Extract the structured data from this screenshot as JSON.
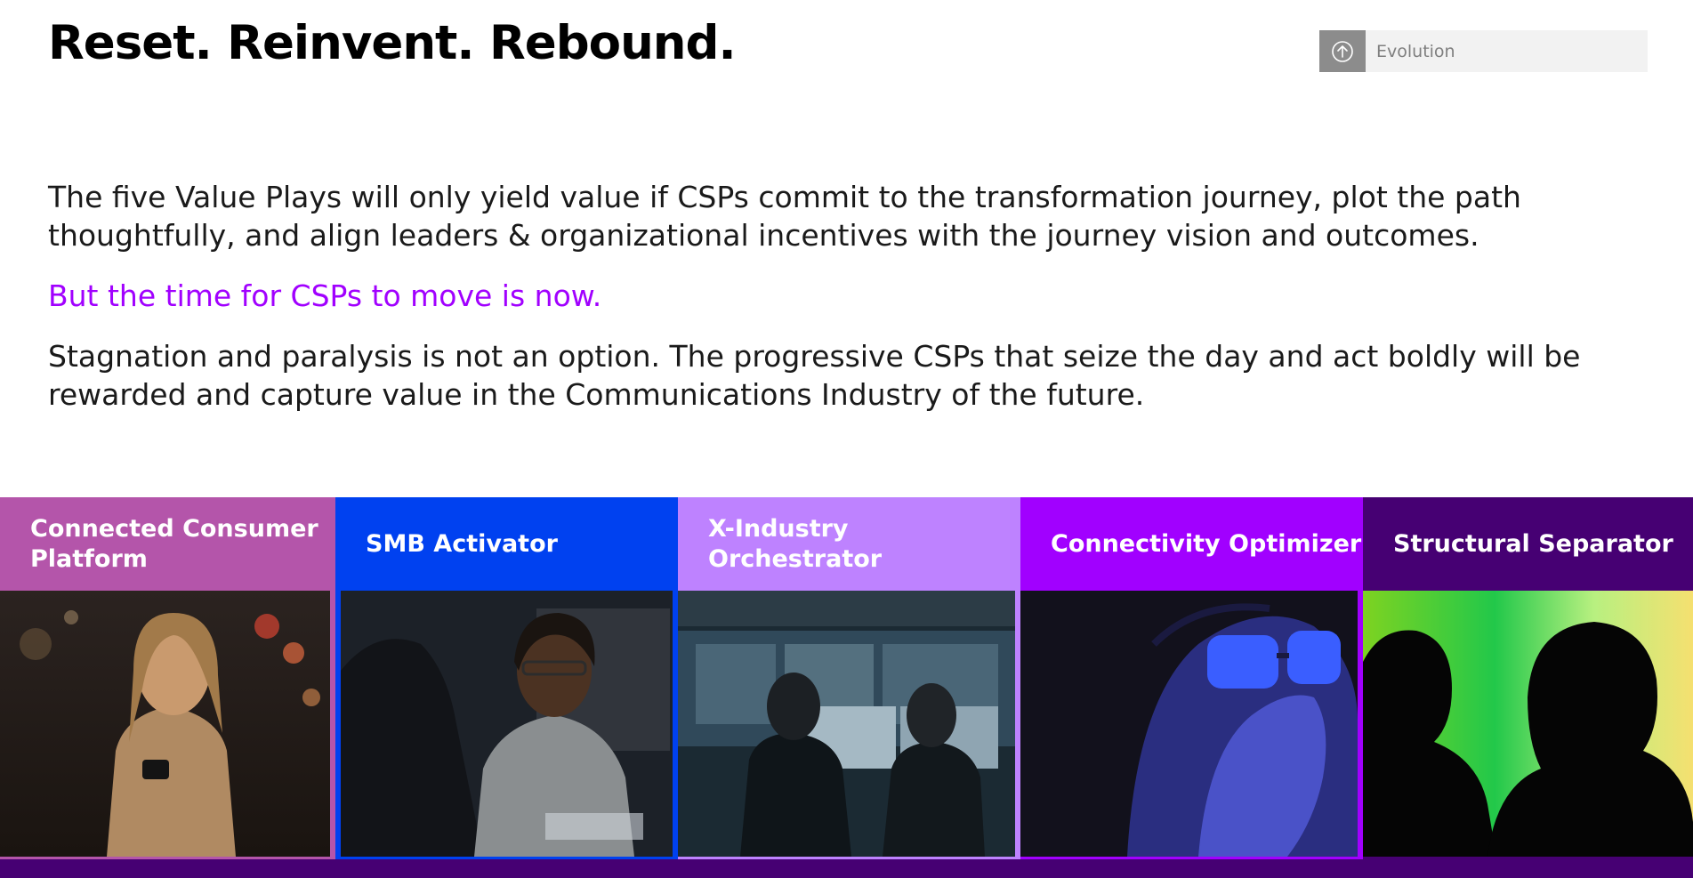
{
  "title": "Reset. Reinvent. Rebound.",
  "section_tag": {
    "label": "Evolution",
    "icon": "arrow-up-circle-icon"
  },
  "paragraphs": {
    "p1": "The five Value Plays will only yield value if CSPs commit to the transformation journey, plot the path thoughtfully, and align leaders & organizational incentives with the journey vision and outcomes.",
    "p2": "But the time for CSPs to move is now.",
    "p3": "Stagnation and paralysis is not an option. The progressive CSPs that seize the day and act boldly will be rewarded and capture value in the Communications Industry of the future."
  },
  "value_plays": [
    {
      "label": "Connected Consumer Platform",
      "color": "#b455aa"
    },
    {
      "label": "SMB Activator",
      "color": "#0041f0"
    },
    {
      "label": "X-Industry Orchestrator",
      "color": "#be82ff"
    },
    {
      "label": "Connectivity Optimizer",
      "color": "#a100ff"
    },
    {
      "label": "Structural Separator",
      "color": "#460073"
    }
  ],
  "colors": {
    "accent": "#a100ff",
    "bottom_bar": "#460073",
    "tag_bg": "#f2f2f2",
    "tag_icon_bg": "#8c8c8c"
  }
}
